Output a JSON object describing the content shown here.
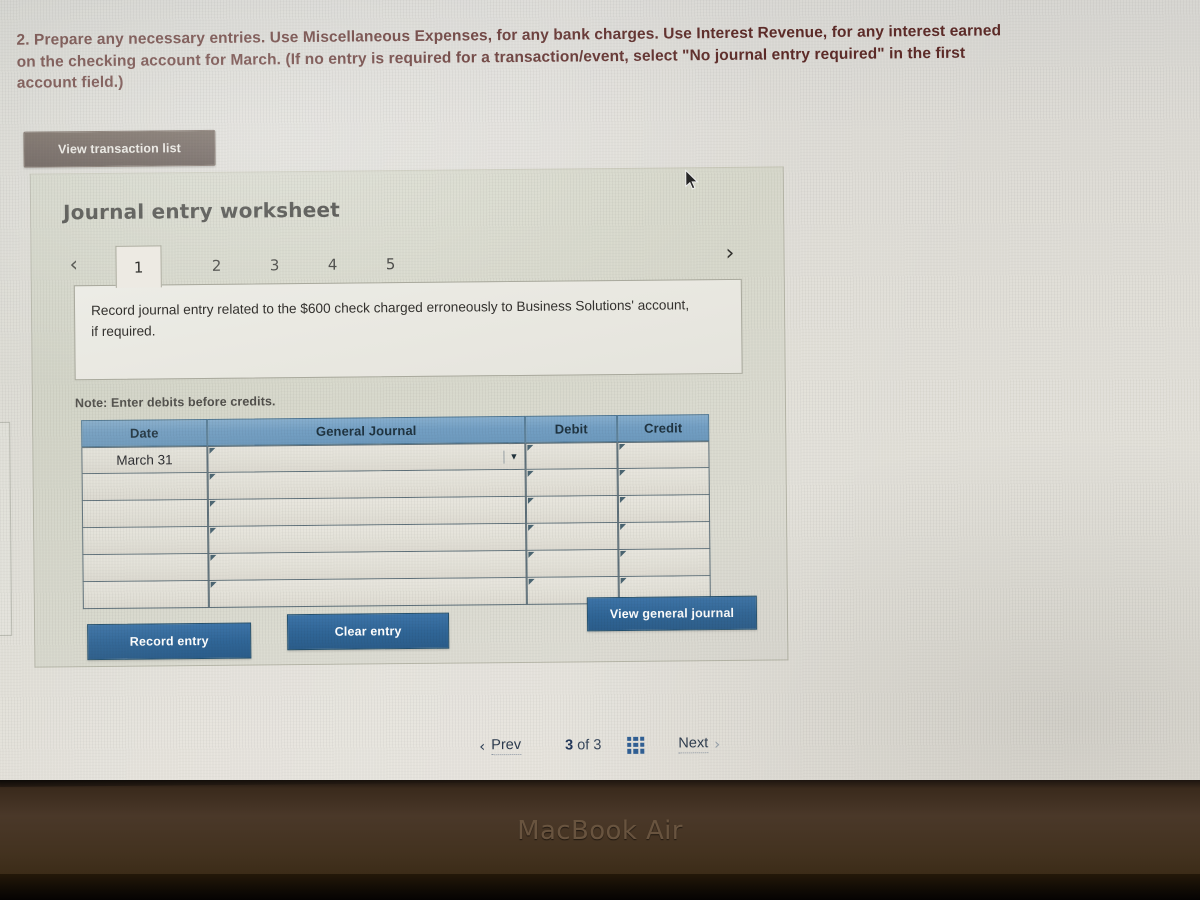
{
  "question": {
    "number": "2.",
    "line1": "Prepare any necessary entries. Use Miscellaneous Expenses, for any bank charges. Use Interest Revenue, for any interest earned",
    "line2": "on the checking account for March. (If no entry is required for a transaction/event, select \"No journal entry required\" in the first",
    "line3": "account field.)"
  },
  "toolbar": {
    "view_transaction_list": "View transaction list"
  },
  "worksheet": {
    "title": "Journal entry worksheet",
    "prev_arrow": "‹",
    "next_arrow": "›",
    "tabs": [
      {
        "label": "1",
        "active": true
      },
      {
        "label": "2",
        "active": false
      },
      {
        "label": "3",
        "active": false
      },
      {
        "label": "4",
        "active": false
      },
      {
        "label": "5",
        "active": false
      }
    ],
    "prompt": "Record journal entry related to the $600 check charged erroneously to Business Solutions' account, if required.",
    "note": "Note: Enter debits before credits.",
    "table": {
      "headers": [
        "Date",
        "General Journal",
        "Debit",
        "Credit"
      ],
      "rows": [
        {
          "date": "March 31",
          "general_journal": "",
          "debit": "",
          "credit": "",
          "has_dropdown": true
        },
        {
          "date": "",
          "general_journal": "",
          "debit": "",
          "credit": "",
          "has_dropdown": false
        },
        {
          "date": "",
          "general_journal": "",
          "debit": "",
          "credit": "",
          "has_dropdown": false
        },
        {
          "date": "",
          "general_journal": "",
          "debit": "",
          "credit": "",
          "has_dropdown": false
        },
        {
          "date": "",
          "general_journal": "",
          "debit": "",
          "credit": "",
          "has_dropdown": false
        },
        {
          "date": "",
          "general_journal": "",
          "debit": "",
          "credit": "",
          "has_dropdown": false
        }
      ]
    },
    "buttons": {
      "record_entry": "Record entry",
      "clear_entry": "Clear entry",
      "view_general_journal": "View general journal"
    }
  },
  "pager": {
    "prev": "Prev",
    "prev_chevron": "‹",
    "current": "3",
    "of": "of",
    "total": "3",
    "next": "Next",
    "next_chevron": "›"
  },
  "device": {
    "logo": "MacBook Air"
  },
  "colors": {
    "question_text": "#5d2b28",
    "panel_bg": "#d6d8ca",
    "table_header_blue": "#739fc3",
    "button_blue": "#2f6596",
    "transaction_button": "#554640"
  }
}
